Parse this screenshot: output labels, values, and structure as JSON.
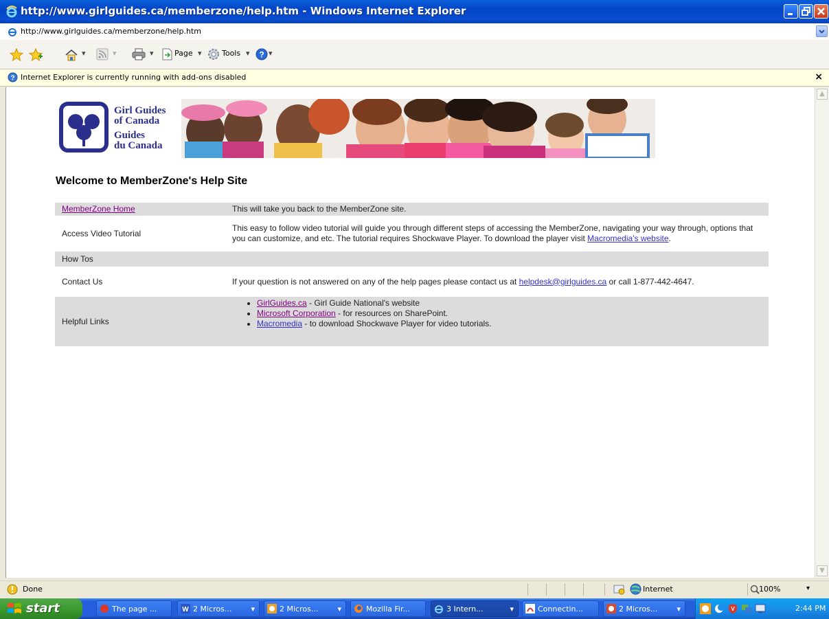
{
  "window": {
    "title": "http://www.girlguides.ca/memberzone/help.htm - Windows Internet Explorer"
  },
  "address": {
    "url": "http://www.girlguides.ca/memberzone/help.htm"
  },
  "toolbar": {
    "page_label": "Page",
    "tools_label": "Tools"
  },
  "infobar": {
    "message": "Internet Explorer is currently running with add-ons disabled",
    "close_glyph": "×"
  },
  "page": {
    "logo": {
      "line1": "Girl Guides",
      "line2": "of Canada",
      "line3": "Guides",
      "line4": "du Canada"
    },
    "heading": "Welcome to MemberZone's Help Site",
    "rows": {
      "r1": {
        "label": "MemberZone Home",
        "desc": "This will take you back to the MemberZone site."
      },
      "r2": {
        "label": "Access Video Tutorial",
        "desc": "This easy to follow video tutorial will guide you through different steps of accessing the MemberZone, navigating your way through, options that you can customize, and etc. The tutorial requires Shockwave Player. To download the player visit ",
        "link": "Macromedia's website",
        "after": "."
      },
      "r3": {
        "label": "How Tos"
      },
      "r4": {
        "label": "Contact Us",
        "desc": "If your question is not answered on any of the help pages please contact us at ",
        "email": "helpdesk@girlguides.ca",
        "after": " or call 1-877-442-4647."
      },
      "r5": {
        "label": "Helpful Links",
        "links": [
          {
            "text": "GirlGuides.ca",
            "rest": " - Girl Guide National's website"
          },
          {
            "text": "Microsoft Corporation",
            "rest": " - for resources on SharePoint."
          },
          {
            "text": "Macromedia",
            "rest": " - to download Shockwave Player for video tutorials."
          }
        ]
      }
    }
  },
  "status": {
    "text": "Done",
    "zone": "Internet",
    "zoom": "100%"
  },
  "taskbar": {
    "start": "start",
    "tasks": [
      "The page ...",
      "2 Micros...",
      "2 Micros...",
      "Mozilla Fir...",
      "3 Intern...",
      "Connectin...",
      "2 Micros..."
    ],
    "clock": "2:44 PM"
  },
  "colors": {
    "titlebar": "#0a4fd0",
    "link": "#3333cc",
    "visited": "#800080",
    "row_shade": "#dcdcdc",
    "start_green": "#3c9a2f"
  }
}
